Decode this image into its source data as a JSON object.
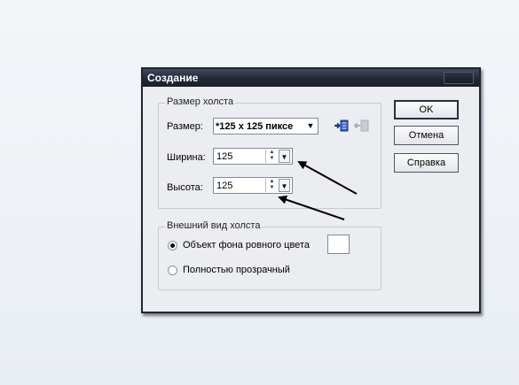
{
  "dialog": {
    "title": "Создание"
  },
  "canvas_size": {
    "group_title": "Размер холста",
    "size_label": "Размер:",
    "size_value": "*125 x 125 пиксе",
    "width_label": "Ширина:",
    "width_value": "125",
    "height_label": "Высота:",
    "height_value": "125"
  },
  "appearance": {
    "group_title": "Внешний вид холста",
    "options": [
      {
        "label": "Объект фона ровного цвета",
        "checked": true
      },
      {
        "label": "Полностью прозрачный",
        "checked": false
      }
    ]
  },
  "buttons": {
    "ok": "OK",
    "cancel": "Отмена",
    "help": "Справка"
  },
  "colors": {
    "titlebar": "#232838",
    "dialog_bg": "#ecedf1",
    "arrow": "#000000"
  },
  "icons": [
    "add-preset-icon",
    "remove-preset-icon",
    "dropdown-arrow-icon",
    "spin-up-icon",
    "spin-down-icon"
  ]
}
